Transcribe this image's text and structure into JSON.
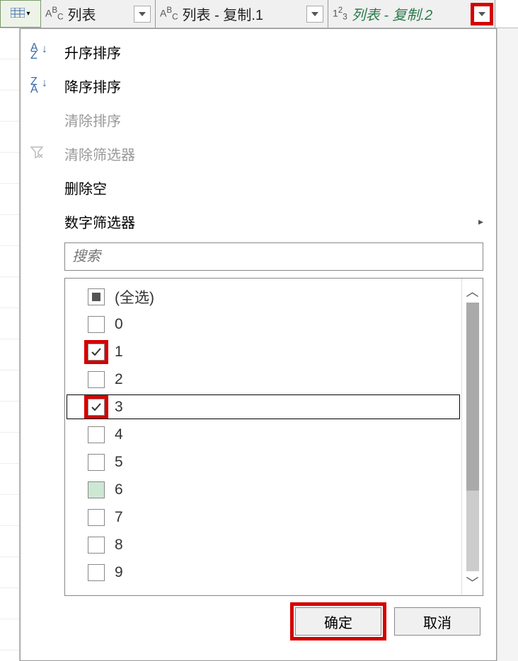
{
  "header": {
    "columns": [
      {
        "typeIcon": "abc",
        "label": "列表"
      },
      {
        "typeIcon": "abc",
        "label": "列表 - 复制.1"
      },
      {
        "typeIcon": "123",
        "label": "列表 - 复制.2"
      }
    ]
  },
  "menu": {
    "sortAsc": "升序排序",
    "sortDesc": "降序排序",
    "clearSort": "清除排序",
    "clearFilter": "清除筛选器",
    "removeEmpty": "删除空",
    "numberFilter": "数字筛选器",
    "searchPlaceholder": "搜索",
    "selectAll": "(全选)",
    "items": [
      {
        "label": "0",
        "checked": false
      },
      {
        "label": "1",
        "checked": true,
        "highlight": true
      },
      {
        "label": "2",
        "checked": false
      },
      {
        "label": "3",
        "checked": true,
        "highlight": true,
        "focused": true
      },
      {
        "label": "4",
        "checked": false
      },
      {
        "label": "5",
        "checked": false
      },
      {
        "label": "6",
        "checked": false,
        "green": true
      },
      {
        "label": "7",
        "checked": false
      },
      {
        "label": "8",
        "checked": false
      },
      {
        "label": "9",
        "checked": false
      }
    ],
    "ok": "确定",
    "cancel": "取消"
  }
}
